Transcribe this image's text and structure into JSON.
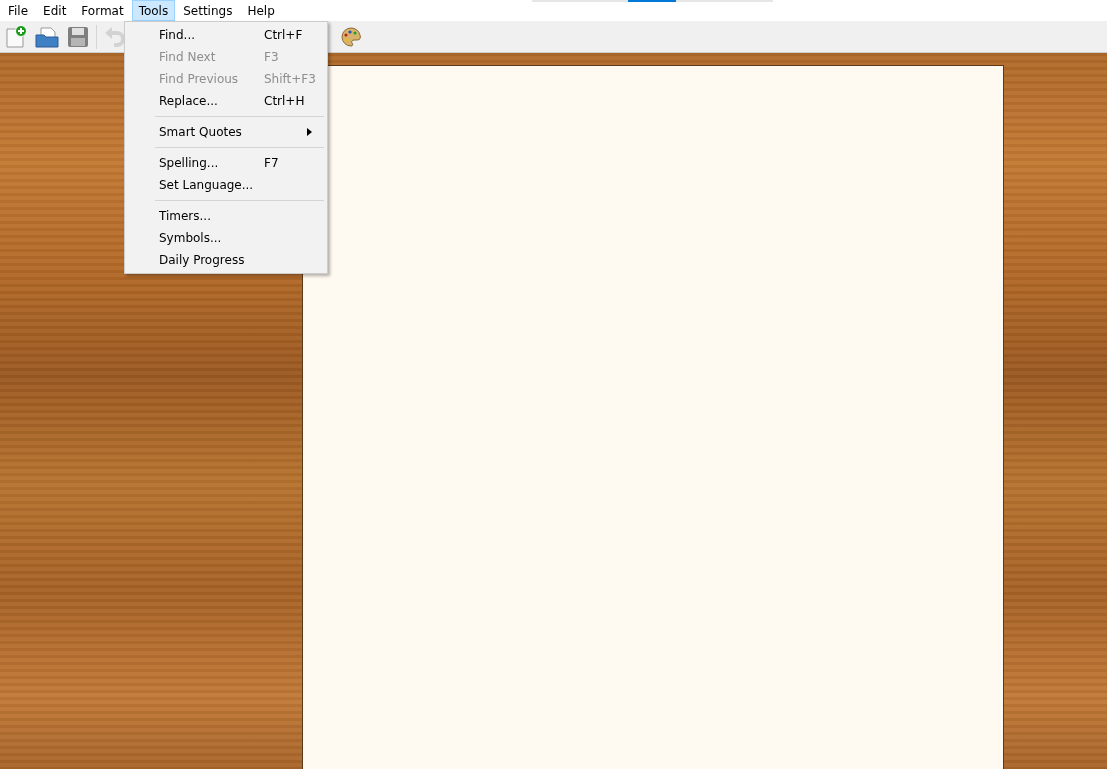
{
  "menu_bar": [
    {
      "label": "File",
      "selected": false
    },
    {
      "label": "Edit",
      "selected": false
    },
    {
      "label": "Format",
      "selected": false
    },
    {
      "label": "Tools",
      "selected": true
    },
    {
      "label": "Settings",
      "selected": false
    },
    {
      "label": "Help",
      "selected": false
    }
  ],
  "toolbar": [
    {
      "kind": "new",
      "disabled": false
    },
    {
      "kind": "open",
      "disabled": false
    },
    {
      "kind": "save",
      "disabled": false
    },
    {
      "kind": "separator"
    },
    {
      "kind": "undo",
      "disabled": true
    }
  ],
  "tools_menu": [
    {
      "kind": "item",
      "label": "Find...",
      "shortcut": "Ctrl+F",
      "disabled": false
    },
    {
      "kind": "item",
      "label": "Find Next",
      "shortcut": "F3",
      "disabled": true
    },
    {
      "kind": "item",
      "label": "Find Previous",
      "shortcut": "Shift+F3",
      "disabled": true
    },
    {
      "kind": "item",
      "label": "Replace...",
      "shortcut": "Ctrl+H",
      "disabled": false
    },
    {
      "kind": "separator"
    },
    {
      "kind": "submenu",
      "label": "Smart Quotes",
      "disabled": false
    },
    {
      "kind": "separator"
    },
    {
      "kind": "item",
      "label": "Spelling...",
      "shortcut": "F7",
      "disabled": false
    },
    {
      "kind": "item",
      "label": "Set Language...",
      "disabled": false
    },
    {
      "kind": "separator"
    },
    {
      "kind": "item",
      "label": "Timers...",
      "disabled": false
    },
    {
      "kind": "item",
      "label": "Symbols...",
      "disabled": false
    },
    {
      "kind": "item",
      "label": "Daily Progress",
      "disabled": false
    }
  ]
}
